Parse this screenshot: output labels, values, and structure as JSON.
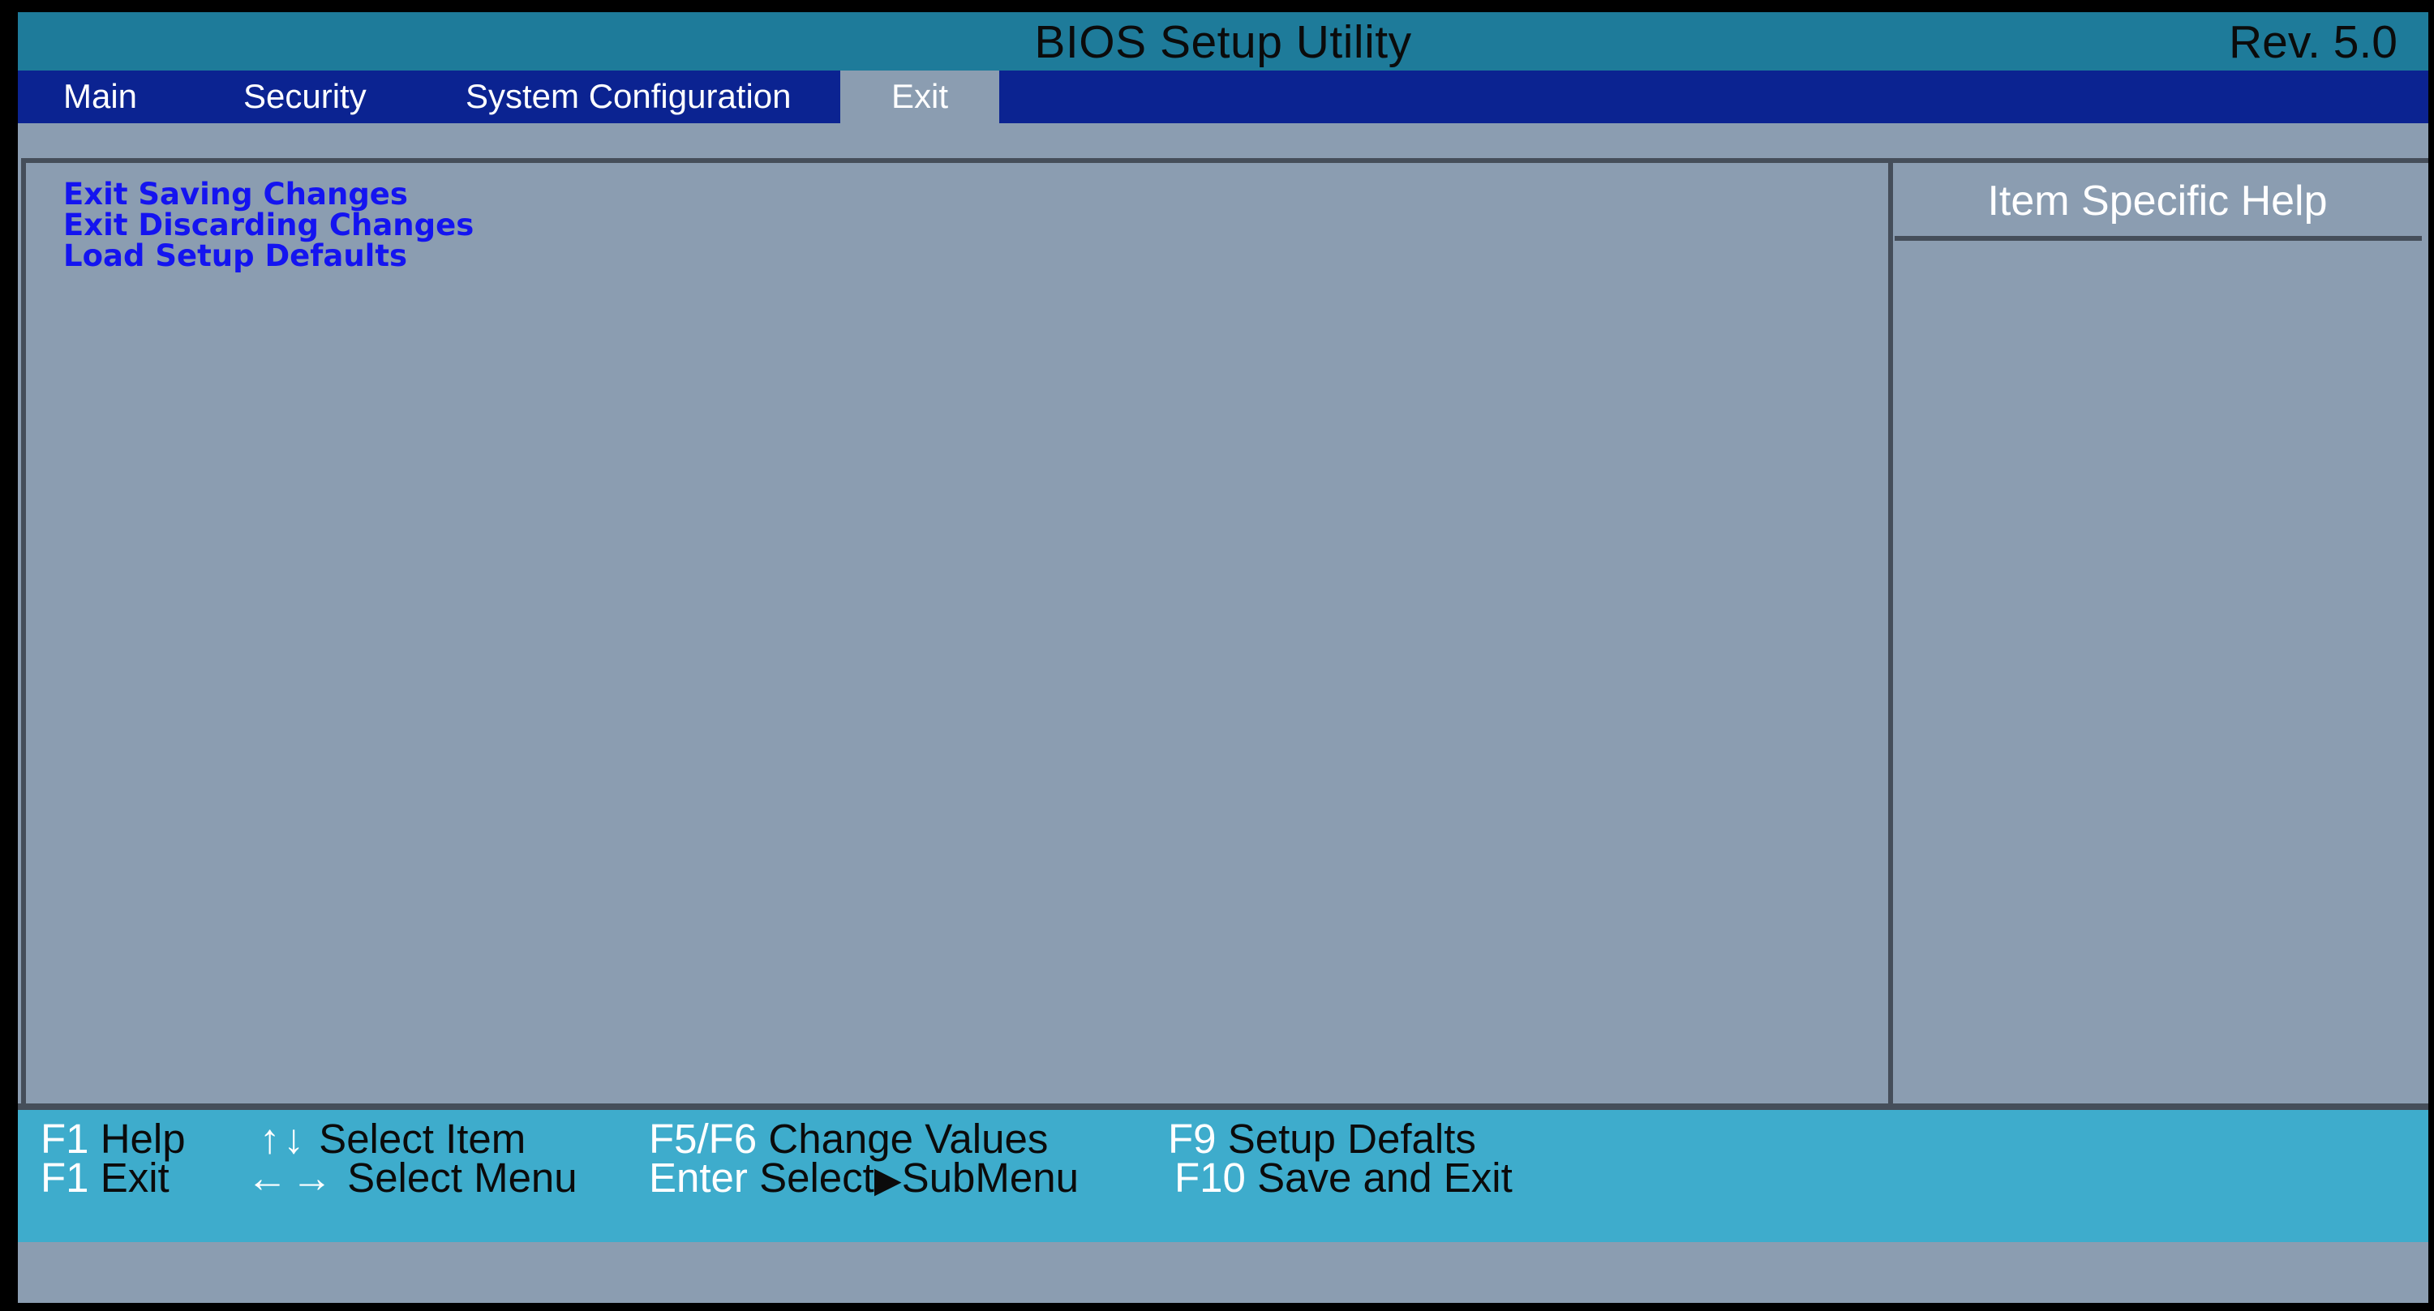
{
  "title_bar": {
    "title": "BIOS Setup Utility",
    "revision": "Rev. 5.0"
  },
  "menu_bar": {
    "tabs": [
      {
        "label": "Main"
      },
      {
        "label": "Security"
      },
      {
        "label": "System Configuration"
      },
      {
        "label": "Exit",
        "selected": true
      }
    ]
  },
  "exit_options": [
    {
      "label": "Exit Saving Changes"
    },
    {
      "label": "Exit Discarding Changes"
    },
    {
      "label": "Load Setup Defaults"
    }
  ],
  "help_panel": {
    "title": "Item Specific Help"
  },
  "footer": {
    "row1": [
      {
        "key": "F1",
        "desc": "Help"
      },
      {
        "key": "↑↓",
        "desc": "Select Item"
      },
      {
        "key": "F5/F6",
        "desc": "Change Values"
      },
      {
        "key": "F9",
        "desc": "Setup Defalts"
      }
    ],
    "row2": [
      {
        "key": "F1",
        "desc": "Exit"
      },
      {
        "key": "←→",
        "desc": "Select Menu"
      },
      {
        "key": "Enter",
        "desc": "Select",
        "glyph": "▶",
        "desc2": "SubMenu"
      },
      {
        "key": "F10",
        "desc": "Save and Exit"
      }
    ]
  },
  "colors": {
    "title_bar_bg": "#1e7b9a",
    "menu_bar_bg": "#0b2391",
    "panel_bg": "#8b9db1",
    "option_text": "#1414f0",
    "footer_bg": "#3eaccc",
    "border": "#454e5a"
  },
  "icons": {
    "up_down_arrows": "up-down-arrows-icon",
    "left_right_arrow": "left-right-arrow-icon",
    "submenu_triangle": "right-triangle-icon"
  }
}
